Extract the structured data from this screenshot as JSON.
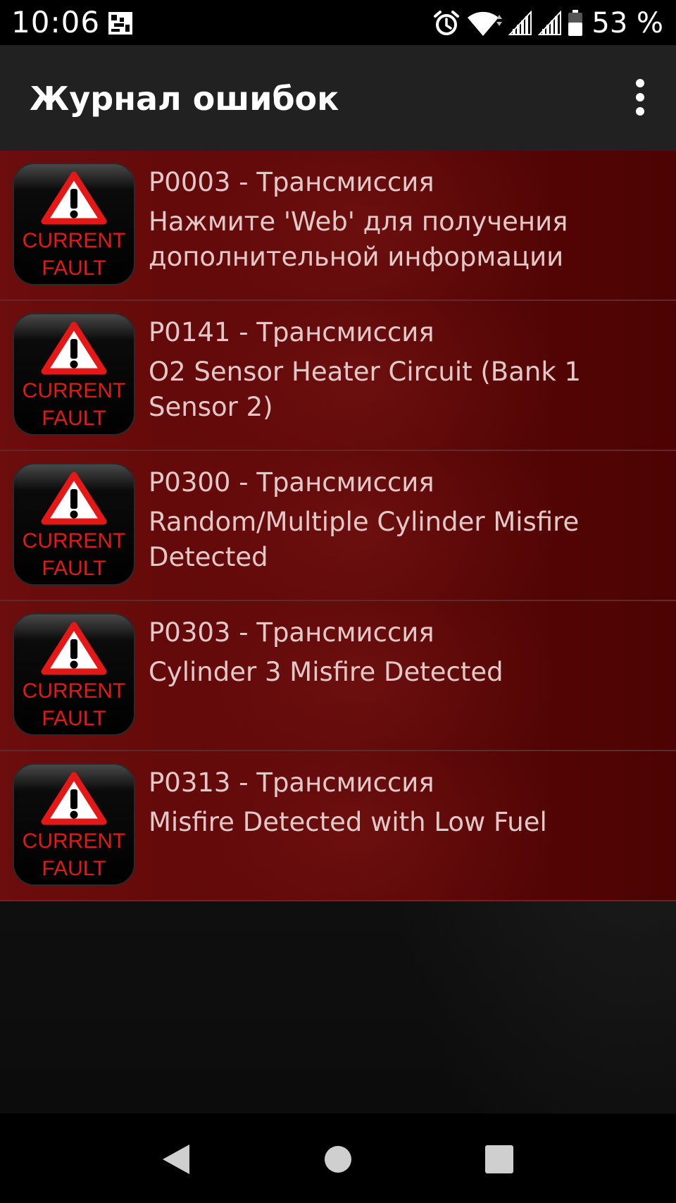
{
  "status_bar": {
    "time": "10:06",
    "battery_percent": "53 %",
    "icons": [
      "notification-image-icon",
      "alarm-icon",
      "wifi-icon",
      "signal-icon",
      "signal-icon",
      "battery-icon"
    ]
  },
  "app_bar": {
    "title": "Журнал ошибок",
    "menu_icon": "more-vertical-icon"
  },
  "colors": {
    "status_bar": "#000000",
    "app_bar": "#212121",
    "row_background": "#5c0707",
    "row_text": "#e3c8c8",
    "badge_red": "#e51818"
  },
  "faults": [
    {
      "code": "P0003 - Трансмиссия",
      "description": "Нажмите 'Web' для получения дополнительной информации",
      "icon": "current-fault-icon",
      "badge_line1": "CURRENT",
      "badge_line2": "FAULT"
    },
    {
      "code": "P0141 - Трансмиссия",
      "description": "O2 Sensor Heater Circuit (Bank 1 Sensor 2)",
      "icon": "current-fault-icon",
      "badge_line1": "CURRENT",
      "badge_line2": "FAULT"
    },
    {
      "code": "P0300 - Трансмиссия",
      "description": "Random/Multiple Cylinder Misfire Detected",
      "icon": "current-fault-icon",
      "badge_line1": "CURRENT",
      "badge_line2": "FAULT"
    },
    {
      "code": "P0303 - Трансмиссия",
      "description": "Cylinder 3 Misfire Detected",
      "icon": "current-fault-icon",
      "badge_line1": "CURRENT",
      "badge_line2": "FAULT"
    },
    {
      "code": "P0313 - Трансмиссия",
      "description": "Misfire Detected with Low Fuel",
      "icon": "current-fault-icon",
      "badge_line1": "CURRENT",
      "badge_line2": "FAULT"
    }
  ],
  "nav_bar": {
    "buttons": [
      "back-icon",
      "home-icon",
      "recents-icon"
    ]
  }
}
